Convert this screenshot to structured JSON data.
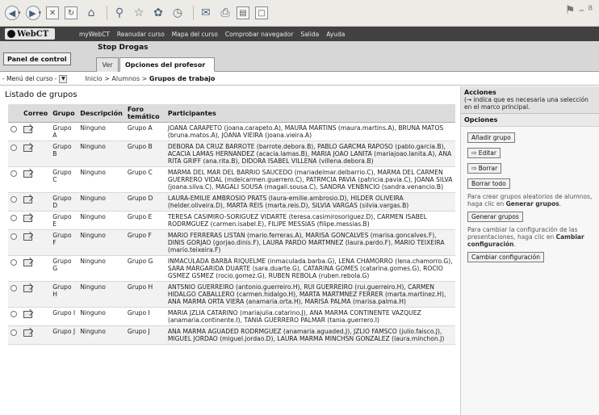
{
  "browser": {
    "back_icon": "back-arrow-icon",
    "forward_icon": "forward-arrow-icon",
    "right_glyph": "⚑ – ⁸"
  },
  "header": {
    "logo": "WebCT",
    "nav": [
      "myWebCT",
      "Reanudar curso",
      "Mapa del curso",
      "Comprobar navegador",
      "Salida",
      "Ayuda"
    ]
  },
  "course": {
    "panel_button": "Panel de control",
    "title": "Stop Drogas",
    "tab_view": "Ver",
    "tab_teacher": "Opciones del profesor"
  },
  "breadcrumb": {
    "menu_label": "- Menú del curso -",
    "path_start": "Inicio > Alumnos > ",
    "current": "Grupos de trabajo"
  },
  "main": {
    "title": "Listado de grupos",
    "columns": [
      "",
      "Correo",
      "Grupo",
      "Descripción",
      "Foro temático",
      "Participantes"
    ],
    "rows": [
      {
        "grupo": "Grupo A",
        "desc": "Ninguno",
        "foro": "Grupo A",
        "participantes": "JOANA CARAPETO (joana.carapeto.A), MAURA MARTINS (maura.martins.A), BRUNA MATOS (bruna.matos.A), JOANA VIEIRA (joana.vieira.A)"
      },
      {
        "grupo": "Grupo B",
        "desc": "Ninguno",
        "foro": "Grupo B",
        "participantes": "DEBORA DA CRUZ BARROTE (barrote.debora.B), PABLO GARCMA RAPOSO (pablo.garcia.B), ACACIA LAMAS HERNANDEZ (acacia.lamas.B), MARIA JOAO LANITA (mariajoao.lanita.A), ANA RITA GRIFF (ana.rita.B), DIDORA ISABEL VILLENA (villena.debora.B)"
      },
      {
        "grupo": "Grupo C",
        "desc": "Ninguno",
        "foro": "Grupo C",
        "participantes": "MARMA DEL MAR DEL BARRIO SAUCEDO (mariadelmar.delbarrio.C), MARMA DEL CARMEN GUERRERO VIDAL (mdelcarmen.guerrero.C), PATRMCIA PAVIA (patricia.pavia.C), JOANA SILVA (joana.silva.C), MAGALI SOUSA (magali.sousa.C), SANDRA VENBNCIO (sandra.venancio.B)"
      },
      {
        "grupo": "Grupo D",
        "desc": "Ninguno",
        "foro": "Grupo D",
        "participantes": "LAURA-EMILIE AMBROSIO PRATS (laura-emilie.ambrosio.D), HILDER OLIVEIRA (helder.oliveira.D), MARTA REIS (marta.reis.D), SILVIA VARGAS (silvia.vargas.B)"
      },
      {
        "grupo": "Grupo E",
        "desc": "Ninguno",
        "foro": "Grupo E",
        "participantes": "TERESA CASIMIRO-SORIGUEZ VIDARTE (teresa.casimirosoriguez.D), CARMEN ISABEL RODRMGUEZ (carmen.isabel.E), FILIPE MESSIAS (filipe.messias.B)"
      },
      {
        "grupo": "Grupo F",
        "desc": "Ninguno",
        "foro": "Grupo F",
        "participantes": "MARIO FERRERAS LISTAN (mario.ferreras.A), MARISA GONCALVES (marisa.goncalves.F), DINIS GORJAO (gorjao.dinis.F), LAURA PARDO MARTMNEZ (laura.pardo.F), MARIO TEIXEIRA (mario.teixeira.F)"
      },
      {
        "grupo": "Grupo G",
        "desc": "Ninguno",
        "foro": "Grupo G",
        "participantes": "INMACULADA BARBA RIQUELME (inmaculada.barba.G), LENA CHAMORRO (lena.chamorro.G), SARA MARGARIDA DUARTE (sara.duarte.G), CATARINA GOMES (catarina.gomes.G), ROCIO GSMEZ GSMEZ (rocio.gomez.G), RUBEN REBOLA (ruben.rebola.G)"
      },
      {
        "grupo": "Grupo H",
        "desc": "Ninguno",
        "foro": "Grupo H",
        "participantes": "ANTSNIO GUERREIRO (antonio.guerreiro.H), RUI GUERREIRO (rui.guerreiro.H), CARMEN HIDALGO CABALLERO (carmen.hidalgo.H), MARTA MARTMNEZ FERRER (marta.martinez.H), ANA MARMA ORTA VIERA (anamaria.orta.H), MARISA PALMA (marisa.palma.H)"
      },
      {
        "grupo": "Grupo I",
        "desc": "Ninguno",
        "foro": "Grupo I",
        "participantes": "MARIA JZLIA CATARINO (mariajulia.catarino.J), ANA MARMA CONTINENTE VAZQUEZ (anamaria.continente.I), TANIA GUERRERO PALMAR (tania.guerrero.I)"
      },
      {
        "grupo": "Grupo J",
        "desc": "Ninguno",
        "foro": "Grupo J",
        "participantes": "ANA MARMA AGUADED RODRMGUEZ (anamaria.aguaded.J), JZLIO FAMSCO (julio.faisco.J), MIGUEL JORDAO (miguel.jordao.D), LAURA MARMA MINCHSN GONZALEZ (laura.minchon.J)"
      }
    ]
  },
  "sidebar": {
    "actions_title": "Acciones",
    "actions_desc": "(→ indica que es necesaria una selección en el marco principal.",
    "options_title": "Opciones",
    "add_group": "Añadir grupo",
    "edit": "Editar",
    "delete": "Borrar",
    "delete_all": "Borrar todo",
    "random_note_a": "Para crear grupos aleatorios de alumnos, haga clic en ",
    "random_note_b": "Generar grupos",
    "generate": "Generar grupos",
    "config_note_a": "Para cambiar la configuración de las presentaciones, haga clic en ",
    "config_note_b": "Cambiar configuración",
    "change_config": "Cambiar configuración"
  }
}
